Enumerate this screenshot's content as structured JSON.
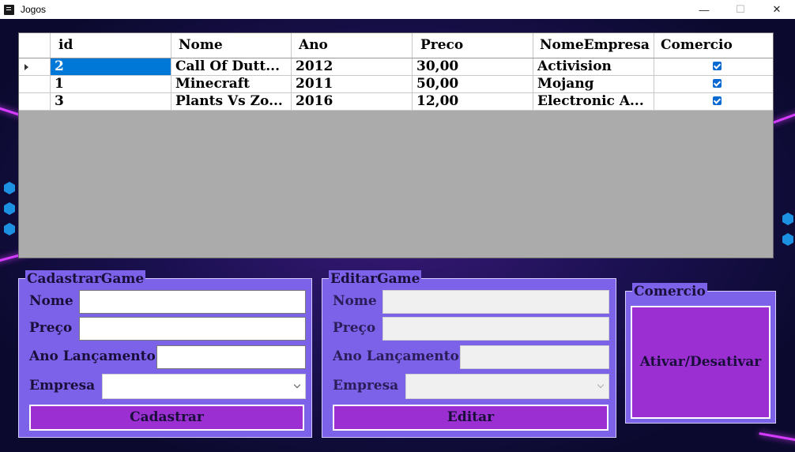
{
  "window": {
    "title": "Jogos",
    "controls": {
      "minimize": "—",
      "maximize": "☐",
      "close": "✕"
    }
  },
  "grid": {
    "columns": [
      "id",
      "Nome",
      "Ano",
      "Preco",
      "NomeEmpresa",
      "Comercio"
    ],
    "rows": [
      {
        "id": "2",
        "nome": "Call Of Dutt...",
        "ano": "2012",
        "preco": "30,00",
        "empresa": "Activision",
        "comercio": true,
        "selected": true
      },
      {
        "id": "1",
        "nome": "Minecraft",
        "ano": "2011",
        "preco": "50,00",
        "empresa": "Mojang",
        "comercio": true,
        "selected": false
      },
      {
        "id": "3",
        "nome": "Plants Vs Zo...",
        "ano": "2016",
        "preco": "12,00",
        "empresa": "Electronic A...",
        "comercio": true,
        "selected": false
      }
    ]
  },
  "cadastrar": {
    "legend": "CadastrarGame",
    "nome_label": "Nome",
    "nome_value": "",
    "preco_label": "Preço",
    "preco_value": "",
    "ano_label": "Ano Lançamento",
    "ano_value": "",
    "empresa_label": "Empresa",
    "empresa_value": "",
    "button": "Cadastrar"
  },
  "editar": {
    "legend": "EditarGame",
    "nome_label": "Nome",
    "nome_value": "",
    "preco_label": "Preço",
    "preco_value": "",
    "ano_label": "Ano Lançamento",
    "ano_value": "",
    "empresa_label": "Empresa",
    "empresa_value": "",
    "button": "Editar"
  },
  "comercio": {
    "legend": "Comercio",
    "button": "Ativar/Desativar"
  },
  "colors": {
    "group_bg": "#7b62e8",
    "button_bg": "#9b2fd1",
    "selection": "#0078d7",
    "checkbox": "#0b6ad1"
  }
}
